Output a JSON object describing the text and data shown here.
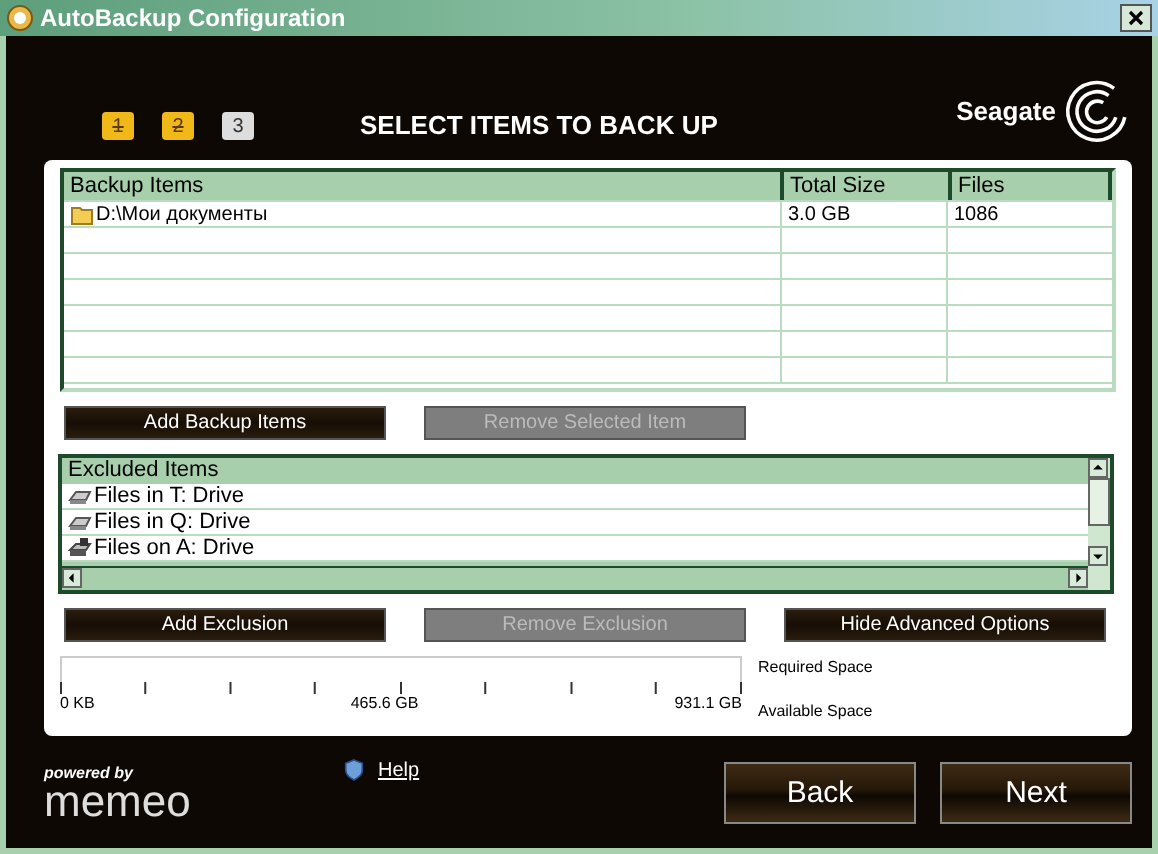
{
  "window": {
    "title": "AutoBackup Configuration"
  },
  "steps": [
    {
      "label": "1",
      "done": true
    },
    {
      "label": "2",
      "done": true
    },
    {
      "label": "3",
      "done": false
    }
  ],
  "heading": "SELECT ITEMS TO BACK UP",
  "brand": "Seagate",
  "backup_table": {
    "columns": [
      "Backup Items",
      "Total Size",
      "Files"
    ],
    "rows": [
      {
        "name": "D:\\Мои документы",
        "size": "3.0 GB",
        "files": "1086"
      }
    ]
  },
  "backup_buttons": [
    {
      "label": "Add Backup Items",
      "disabled": false
    },
    {
      "label": "Remove Selected Item",
      "disabled": true
    }
  ],
  "excluded": {
    "header": "Excluded Items",
    "items": [
      {
        "label": "Files in T: Drive",
        "kind": "drive"
      },
      {
        "label": "Files in Q: Drive",
        "kind": "drive"
      },
      {
        "label": "Files on A: Drive",
        "kind": "floppy"
      }
    ]
  },
  "exclusion_buttons": [
    {
      "label": "Add Exclusion",
      "disabled": false
    },
    {
      "label": "Remove Exclusion",
      "disabled": true
    },
    {
      "label": "Hide Advanced Options",
      "disabled": false
    }
  ],
  "space": {
    "required_label": "Required Space",
    "available_label": "Available Space",
    "scale": [
      "0 KB",
      "465.6 GB",
      "931.1 GB"
    ]
  },
  "footer": {
    "powered_by": "powered by",
    "logo": "memeo",
    "help": "Help"
  },
  "nav": [
    {
      "label": "Back"
    },
    {
      "label": "Next"
    }
  ]
}
